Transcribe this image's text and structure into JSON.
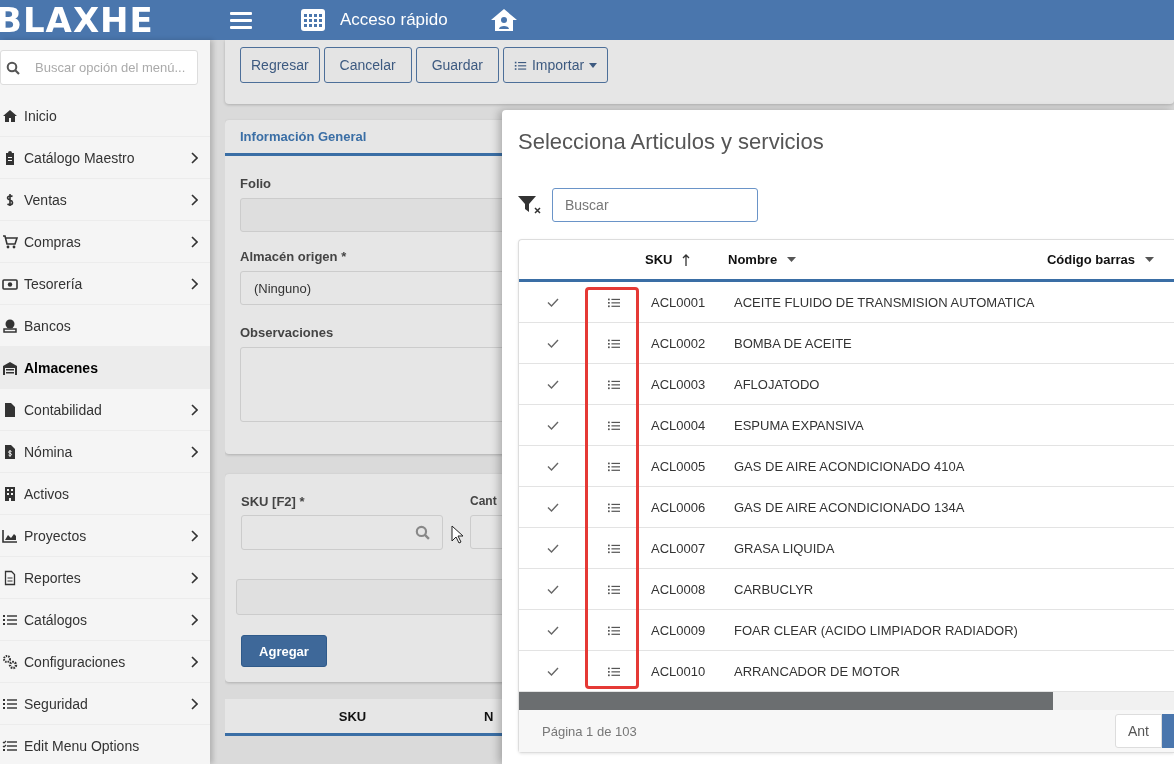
{
  "header": {
    "logo": "BLAXHE",
    "quick_access": "Acceso rápido"
  },
  "sidebar": {
    "search": {
      "placeholder": "Buscar opción del menú..."
    },
    "items": [
      {
        "label": "Inicio",
        "has_submenu": false,
        "selected": false
      },
      {
        "label": "Catálogo Maestro",
        "has_submenu": true,
        "selected": false
      },
      {
        "label": "Ventas",
        "has_submenu": true,
        "selected": false
      },
      {
        "label": "Compras",
        "has_submenu": true,
        "selected": false
      },
      {
        "label": "Tesorería",
        "has_submenu": true,
        "selected": false
      },
      {
        "label": "Bancos",
        "has_submenu": false,
        "selected": false
      },
      {
        "label": "Almacenes",
        "has_submenu": false,
        "selected": true
      },
      {
        "label": "Contabilidad",
        "has_submenu": true,
        "selected": false
      },
      {
        "label": "Nómina",
        "has_submenu": true,
        "selected": false
      },
      {
        "label": "Activos",
        "has_submenu": false,
        "selected": false
      },
      {
        "label": "Proyectos",
        "has_submenu": true,
        "selected": false
      },
      {
        "label": "Reportes",
        "has_submenu": true,
        "selected": false
      },
      {
        "label": "Catálogos",
        "has_submenu": true,
        "selected": false
      },
      {
        "label": "Configuraciones",
        "has_submenu": true,
        "selected": false
      },
      {
        "label": "Seguridad",
        "has_submenu": true,
        "selected": false
      },
      {
        "label": "Edit Menu Options",
        "has_submenu": false,
        "selected": false
      }
    ]
  },
  "toolbar": {
    "buttons": [
      {
        "label": "Regresar",
        "kind": "plain"
      },
      {
        "label": "Cancelar",
        "kind": "plain"
      },
      {
        "label": "Guardar",
        "kind": "plain"
      },
      {
        "label": "Importar",
        "kind": "dropdown"
      }
    ]
  },
  "general_info": {
    "title": "Información General",
    "fields": [
      {
        "label": "Folio",
        "kind": "input"
      },
      {
        "label": "Almacén origen *",
        "kind": "select",
        "value": "(Ninguno)"
      },
      {
        "label": "Observaciones",
        "kind": "textarea"
      }
    ]
  },
  "item_entry": {
    "sku_label": "SKU [F2] *",
    "quantity_label": "Cant",
    "add_button": "Agregar"
  },
  "detail_table": {
    "columns": [
      "SKU",
      "N"
    ]
  },
  "modal": {
    "title": "Selecciona Articulos y servicios",
    "search": {
      "placeholder": "Buscar"
    },
    "columns": [
      "SKU",
      "Nombre",
      "Código barras"
    ],
    "rows": [
      {
        "sku": "ACL0001",
        "name": "ACEITE FLUIDO DE TRANSMISION AUTOMATICA"
      },
      {
        "sku": "ACL0002",
        "name": "BOMBA DE ACEITE"
      },
      {
        "sku": "ACL0003",
        "name": "AFLOJATODO"
      },
      {
        "sku": "ACL0004",
        "name": "ESPUMA EXPANSIVA"
      },
      {
        "sku": "ACL0005",
        "name": "GAS DE AIRE ACONDICIONADO 410A"
      },
      {
        "sku": "ACL0006",
        "name": "GAS DE AIRE ACONDICIONADO 134A"
      },
      {
        "sku": "ACL0007",
        "name": "GRASA LIQUIDA"
      },
      {
        "sku": "ACL0008",
        "name": "CARBUCLYR"
      },
      {
        "sku": "ACL0009",
        "name": "FOAR CLEAR (ACIDO LIMPIADOR RADIADOR)"
      },
      {
        "sku": "ACL0010",
        "name": "ARRANCADOR DE MOTOR"
      }
    ],
    "pager": {
      "status": "Página 1 de 103",
      "prev": "Ant"
    }
  }
}
